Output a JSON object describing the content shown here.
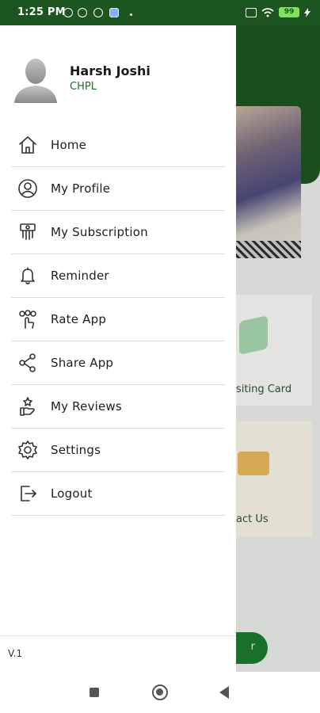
{
  "status_bar": {
    "time": "1:25 PM",
    "battery": "99"
  },
  "drawer": {
    "user": {
      "name": "Harsh Joshi",
      "org": "CHPL"
    },
    "menu": [
      {
        "label": "Home",
        "icon": "home-icon"
      },
      {
        "label": "My Profile",
        "icon": "profile-icon"
      },
      {
        "label": "My Subscription",
        "icon": "subscription-icon"
      },
      {
        "label": "Reminder",
        "icon": "bell-icon"
      },
      {
        "label": "Rate App",
        "icon": "rate-icon"
      },
      {
        "label": "Share App",
        "icon": "share-icon"
      },
      {
        "label": "My Reviews",
        "icon": "reviews-icon"
      },
      {
        "label": "Settings",
        "icon": "gear-icon"
      },
      {
        "label": "Logout",
        "icon": "logout-icon"
      }
    ],
    "version": "V.1"
  },
  "background": {
    "card1_label": "siting Card",
    "card2_label": "act Us",
    "button_label": "r"
  },
  "colors": {
    "brand_green": "#1d5520",
    "accent_green": "#1e6e2a"
  }
}
